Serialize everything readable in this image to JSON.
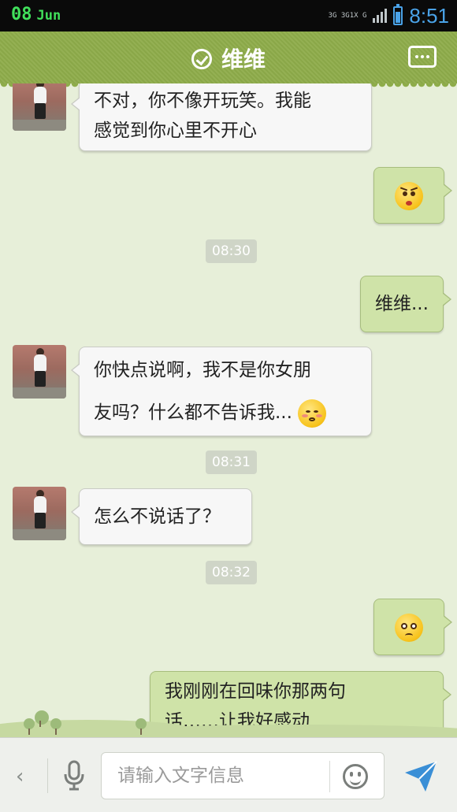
{
  "status_bar": {
    "date_day": "08",
    "date_month": "Jun",
    "network_top": "3G 3G1X G",
    "time": "8:51"
  },
  "header": {
    "title": "维维",
    "title_icon": "check-circle-icon",
    "menu_icon": "more-icon"
  },
  "messages": [
    {
      "side": "left",
      "text_lines": [
        "不对，你不像开玩笑。我能",
        "感觉到你心里不开心"
      ]
    },
    {
      "side": "right",
      "emoji": "angry-emoji"
    },
    {
      "type": "time",
      "text": "08:30"
    },
    {
      "side": "right",
      "text": "维维..."
    },
    {
      "side": "left",
      "text_lines": [
        "你快点说啊，我不是你女朋",
        "友吗？什么都不告诉我..."
      ],
      "emoji": "shy-emoji"
    },
    {
      "type": "time",
      "text": "08:31"
    },
    {
      "side": "left",
      "text": "怎么不说话了？"
    },
    {
      "type": "time",
      "text": "08:32"
    },
    {
      "side": "right",
      "emoji": "teary-emoji"
    },
    {
      "side": "right",
      "text_lines": [
        "我刚刚在回味你那两句",
        "话……让我好感动"
      ]
    }
  ],
  "input_bar": {
    "back_label": "‹",
    "placeholder": "请输入文字信息",
    "mic_icon": "microphone-icon",
    "emoji_icon": "smiley-icon",
    "send_icon": "send-icon"
  },
  "colors": {
    "header": "#8eac4a",
    "chat_bg": "#e7efd9",
    "bubble_right": "#cfe3a8",
    "bubble_left": "#f7f7f7",
    "status_time": "#4aa3e8",
    "status_date": "#41e05b"
  }
}
